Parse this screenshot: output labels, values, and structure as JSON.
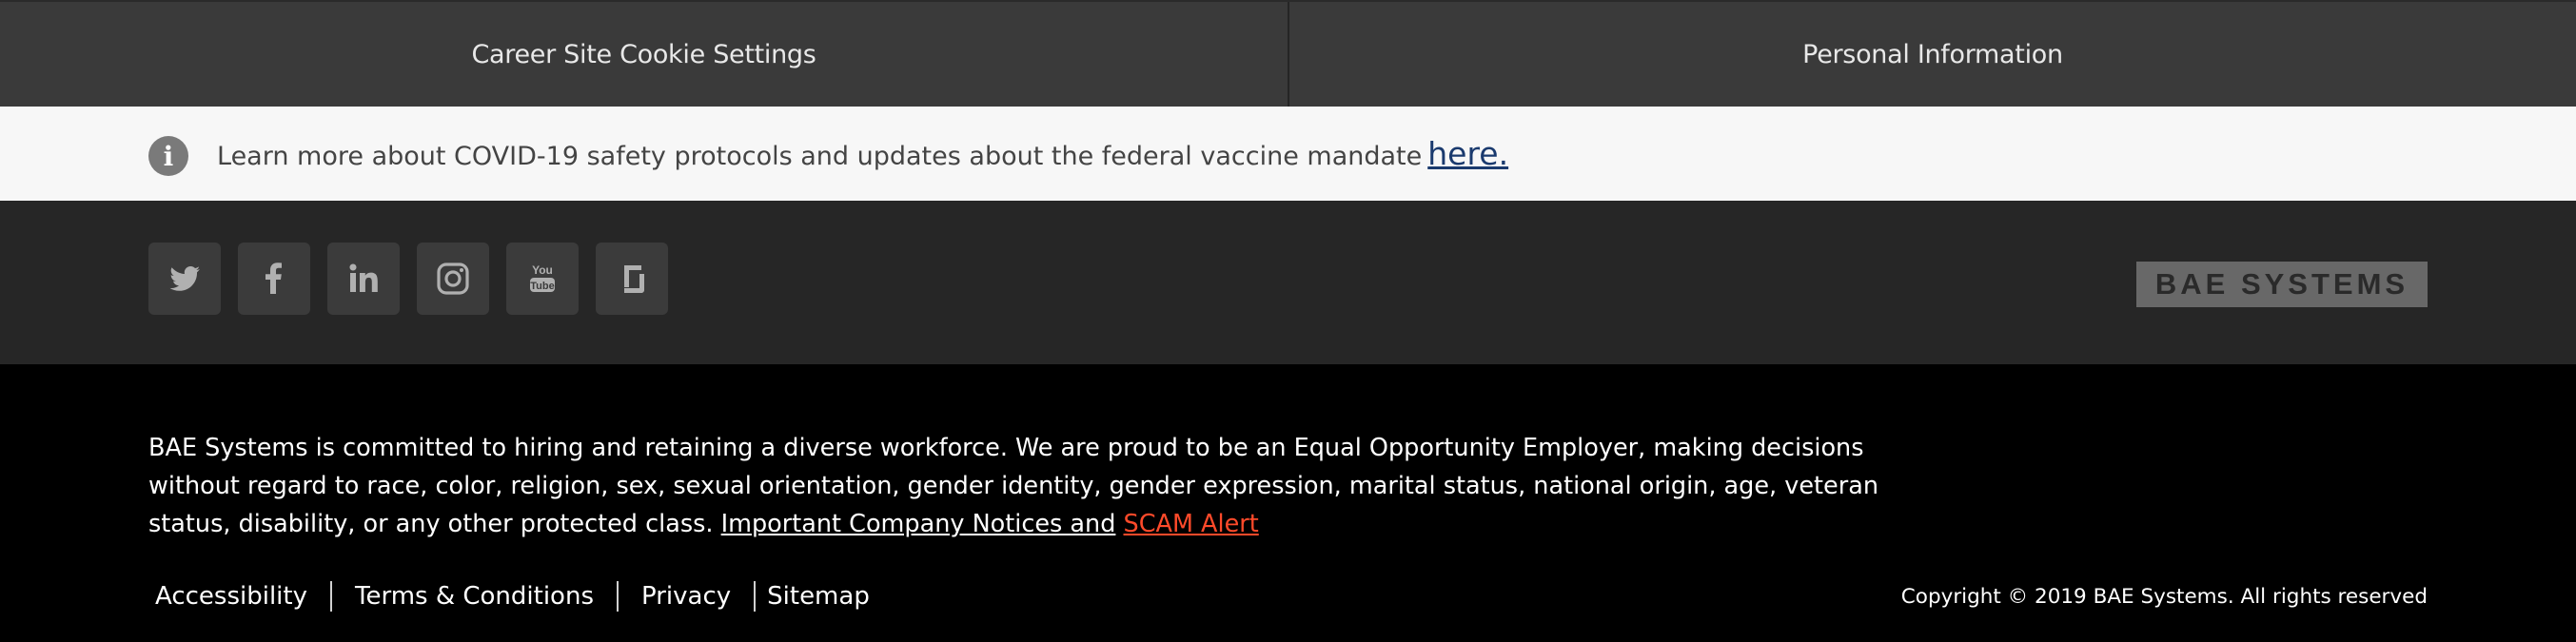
{
  "topbar": {
    "left_label": "Career Site Cookie Settings",
    "right_label": "Personal Information"
  },
  "covid_banner": {
    "icon": "info-icon",
    "text": "Learn more about COVID-19 safety protocols and updates about the federal vaccine mandate",
    "link_label": "here."
  },
  "social": {
    "icons": [
      "twitter-icon",
      "facebook-icon",
      "linkedin-icon",
      "instagram-icon",
      "youtube-icon",
      "glassdoor-icon"
    ],
    "logo_text": "BAE SYSTEMS"
  },
  "footer": {
    "eeo_text": "BAE Systems is committed to hiring and retaining a diverse workforce. We are proud to be an Equal Opportunity Employer, making decisions without regard to race, color, religion, sex, sexual orientation, gender identity, gender expression, marital status, national origin, age, veteran status, disability, or any other protected class.",
    "notices_link": "Important Company Notices and",
    "scam_link": "SCAM Alert",
    "links": [
      "Accessibility",
      "Terms & Conditions",
      "Privacy",
      "Sitemap"
    ],
    "copyright": "Copyright © 2019 BAE Systems. All rights reserved"
  },
  "colors": {
    "topbar_bg": "#3a3a3a",
    "banner_bg": "#f7f7f7",
    "social_bg": "#262626",
    "footer_bg": "#000000",
    "scam_accent": "#ff4a2a",
    "link_blue": "#1a3a6e"
  }
}
